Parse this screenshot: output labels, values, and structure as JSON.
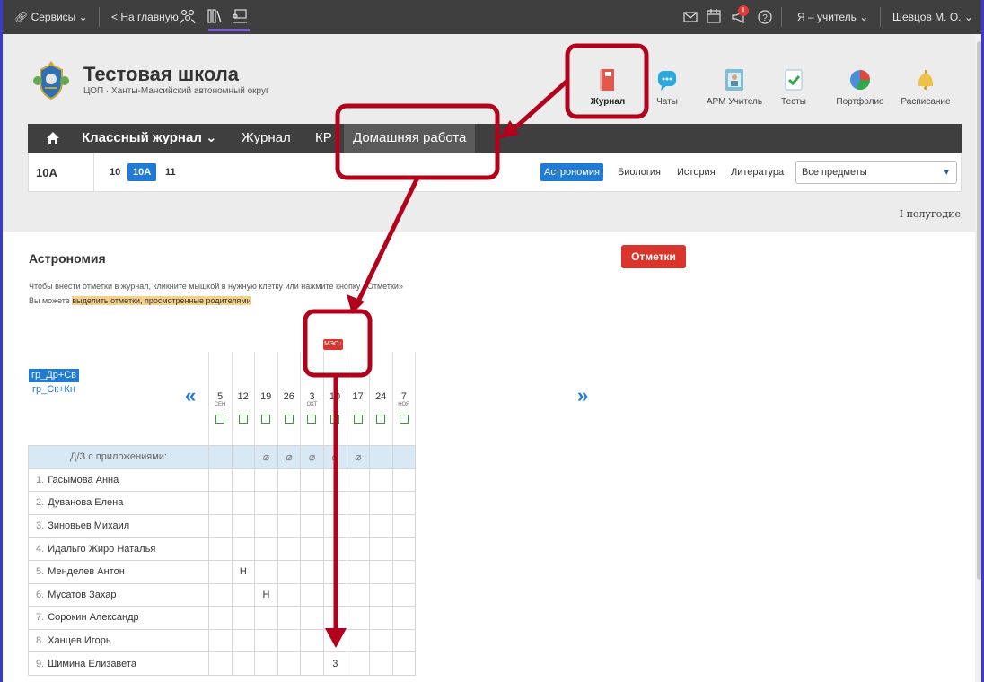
{
  "topbar": {
    "services": "Сервисы",
    "home_link": "< На главную",
    "role": "Я – учитель",
    "user": "Шевцов М. О.",
    "notify_count": "!"
  },
  "header": {
    "school_name": "Тестовая школа",
    "school_sub": "ЦОП · Ханты-Мансийский автономный округ",
    "apps": [
      {
        "label": "Журнал",
        "icon": "journal-icon"
      },
      {
        "label": "Чаты",
        "icon": "chat-icon"
      },
      {
        "label": "АРМ Учитель",
        "icon": "teacher-icon"
      },
      {
        "label": "Тесты",
        "icon": "tests-icon"
      },
      {
        "label": "Портфолио",
        "icon": "portfolio-icon"
      },
      {
        "label": "Расписание",
        "icon": "bell-icon"
      }
    ]
  },
  "nav": {
    "home_icon": "home-icon",
    "class_journal": "Классный журнал",
    "journal": "Журнал",
    "kr": "КР",
    "homework": "Домашняя работа"
  },
  "classbar": {
    "current": "10А",
    "classes": [
      "10",
      "10А",
      "11"
    ],
    "subjects": [
      "Астрономия",
      "Биология",
      "История",
      "Литература"
    ],
    "subject_select": "Все предметы"
  },
  "period": "I полугодие",
  "content": {
    "subject_title": "Астрономия",
    "marks_button": "Отметки",
    "hint1": "Чтобы внести отметки в журнал, кликните мышкой в нужную клетку или нажмите кнопку «Отметки»",
    "hint2_prefix": "Вы можете ",
    "hint2_link": "выделить отметки, просмотренные родителями",
    "groups": [
      "гр_Др+Св",
      "гр_Ск+Кн"
    ],
    "meo_label": "МЭО"
  },
  "journal": {
    "dates": [
      {
        "day": "5",
        "month": "СЕН"
      },
      {
        "day": "12",
        "month": ""
      },
      {
        "day": "19",
        "month": ""
      },
      {
        "day": "26",
        "month": ""
      },
      {
        "day": "3",
        "month": "ОКТ"
      },
      {
        "day": "10",
        "month": ""
      },
      {
        "day": "17",
        "month": ""
      },
      {
        "day": "24",
        "month": ""
      },
      {
        "day": "7",
        "month": "НОЯ"
      }
    ],
    "hw_row_label": "Д/З с приложениями:",
    "hw_attachments": [
      false,
      false,
      true,
      true,
      true,
      true,
      true,
      false,
      false
    ],
    "students": [
      {
        "num": "1.",
        "name": "Гасымова Анна",
        "marks": [
          "",
          "",
          "",
          "",
          "",
          "",
          "",
          "",
          ""
        ]
      },
      {
        "num": "2.",
        "name": "Дуванова Елена",
        "marks": [
          "",
          "",
          "",
          "",
          "",
          "",
          "",
          "",
          ""
        ]
      },
      {
        "num": "3.",
        "name": "Зиновьев Михаил",
        "marks": [
          "",
          "",
          "",
          "",
          "",
          "",
          "",
          "",
          ""
        ]
      },
      {
        "num": "4.",
        "name": "Идальго Жиро Наталья",
        "marks": [
          "",
          "",
          "",
          "",
          "",
          "",
          "",
          "",
          ""
        ]
      },
      {
        "num": "5.",
        "name": "Менделев Антон",
        "marks": [
          "",
          "Н",
          "",
          "",
          "",
          "",
          "",
          "",
          ""
        ]
      },
      {
        "num": "6.",
        "name": "Мусатов Захар",
        "marks": [
          "",
          "",
          "Н",
          "",
          "",
          "",
          "",
          "",
          ""
        ]
      },
      {
        "num": "7.",
        "name": "Сорокин Александр",
        "marks": [
          "",
          "",
          "",
          "",
          "",
          "",
          "",
          "",
          ""
        ]
      },
      {
        "num": "8.",
        "name": "Ханцев Игорь",
        "marks": [
          "",
          "",
          "",
          "",
          "",
          "",
          "",
          "",
          ""
        ]
      },
      {
        "num": "9.",
        "name": "Шимина Елизавета",
        "marks": [
          "",
          "",
          "",
          "",
          "",
          "3",
          "",
          "",
          ""
        ]
      }
    ]
  },
  "colors": {
    "accent": "#1e7bd6",
    "danger": "#d9352c",
    "annotation": "#b3001b",
    "topbar": "#3f3f3f"
  }
}
